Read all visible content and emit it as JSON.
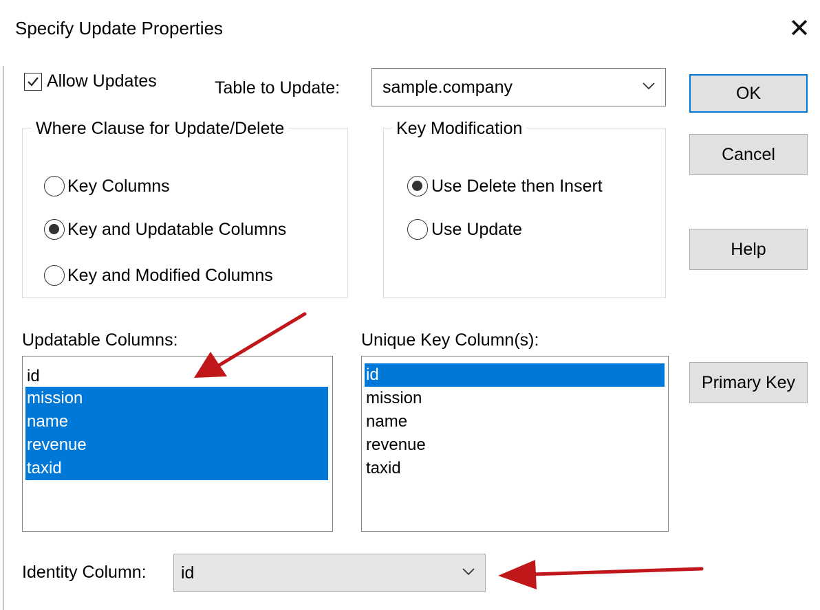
{
  "dialog": {
    "title": "Specify Update Properties"
  },
  "allow_updates": {
    "label": "Allow Updates",
    "checked": true
  },
  "table_to_update": {
    "label": "Table to Update:",
    "value": "sample.company"
  },
  "buttons": {
    "ok": "OK",
    "cancel": "Cancel",
    "help": "Help",
    "primary_key": "Primary Key"
  },
  "where_clause": {
    "title": "Where Clause for Update/Delete",
    "options": [
      "Key Columns",
      "Key and Updatable Columns",
      "Key and Modified Columns"
    ],
    "selected_index": 1
  },
  "key_modification": {
    "title": "Key Modification",
    "options": [
      "Use Delete then Insert",
      "Use Update"
    ],
    "selected_index": 0
  },
  "updatable_columns": {
    "label": "Updatable Columns:",
    "items": [
      "id",
      "mission",
      "name",
      "revenue",
      "taxid"
    ],
    "selected": [
      false,
      true,
      true,
      true,
      true
    ]
  },
  "unique_key_columns": {
    "label": "Unique Key Column(s):",
    "items": [
      "id",
      "mission",
      "name",
      "revenue",
      "taxid"
    ],
    "selected": [
      true,
      false,
      false,
      false,
      false
    ]
  },
  "identity_column": {
    "label": "Identity Column:",
    "value": "id"
  },
  "colors": {
    "selection": "#0078d7",
    "default_button_border": "#0078d7",
    "annotation_arrow": "#c0171b"
  }
}
